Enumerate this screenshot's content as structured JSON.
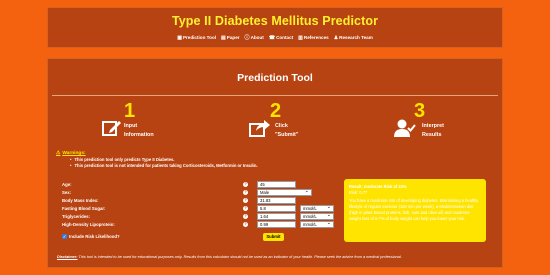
{
  "app": {
    "title": "Type II Diabetes Mellitus Predictor"
  },
  "nav": [
    {
      "icon": "calculator-icon",
      "label": "Prediction Tool"
    },
    {
      "icon": "document-icon",
      "label": "Paper"
    },
    {
      "icon": "info-icon",
      "label": "About"
    },
    {
      "icon": "phone-icon",
      "label": "Contact"
    },
    {
      "icon": "book-icon",
      "label": "References"
    },
    {
      "icon": "group-icon",
      "label": "Research Team"
    }
  ],
  "panel": {
    "title": "Prediction Tool"
  },
  "steps": [
    {
      "number": "1",
      "line1": "Input",
      "line2": "Information",
      "icon": "edit-icon"
    },
    {
      "number": "2",
      "line1": "Click",
      "line2": "\"Submit\"",
      "icon": "share-icon"
    },
    {
      "number": "3",
      "line1": "Interpret",
      "line2": "Results",
      "icon": "user-check-icon"
    }
  ],
  "warnings": {
    "heading": "Warnings:",
    "items": [
      "This prediction tool only predicts Type II Diabetes.",
      "This prediction tool is not intended for patients taking Corticosteroids, Metformin or Insulin."
    ]
  },
  "form": {
    "fields": [
      {
        "label": "Age:",
        "type": "input",
        "value": "45"
      },
      {
        "label": "Sex:",
        "type": "select",
        "value": "Male"
      },
      {
        "label": "Body Mass Index:",
        "type": "input",
        "value": "31.83"
      },
      {
        "label": "Fasting Blood Sugar:",
        "type": "input",
        "value": "5.8",
        "unit": "mmol/L"
      },
      {
        "label": "Triglycerides:",
        "type": "input",
        "value": "1.64",
        "unit": "mmol/L"
      },
      {
        "label": "High-Density Lipoprotein:",
        "type": "input",
        "value": "0.99",
        "unit": "mmol/L"
      }
    ],
    "help_glyph": "?",
    "include_risk_label": "Include Risk Likelihood?",
    "submit_label": "Submit"
  },
  "result": {
    "line1": "Result: moderate Risk of 23%",
    "line2": "Risk: 0.77",
    "body": "You have a moderate risk of developing diabetes. Maintaining a healthy lifestyle of regular exercise (150 min per week), a Mediterranean diet (high in plant-based proteins, fish, nuts and olive oil) and moderate weight loss of 5-7% of body weight can help you lower your risk."
  },
  "disclaimer": {
    "label": "Disclaimer:",
    "text": " This tool is intended to be used for educational purposes only. Results from this calculator should not be used as an indicator of your health. Please seek the advice from a medical professional."
  },
  "colors": {
    "background": "#f4610f",
    "panel": "#b84312",
    "accent_yellow": "#ffe400",
    "title_yellow": "#fff12e"
  }
}
